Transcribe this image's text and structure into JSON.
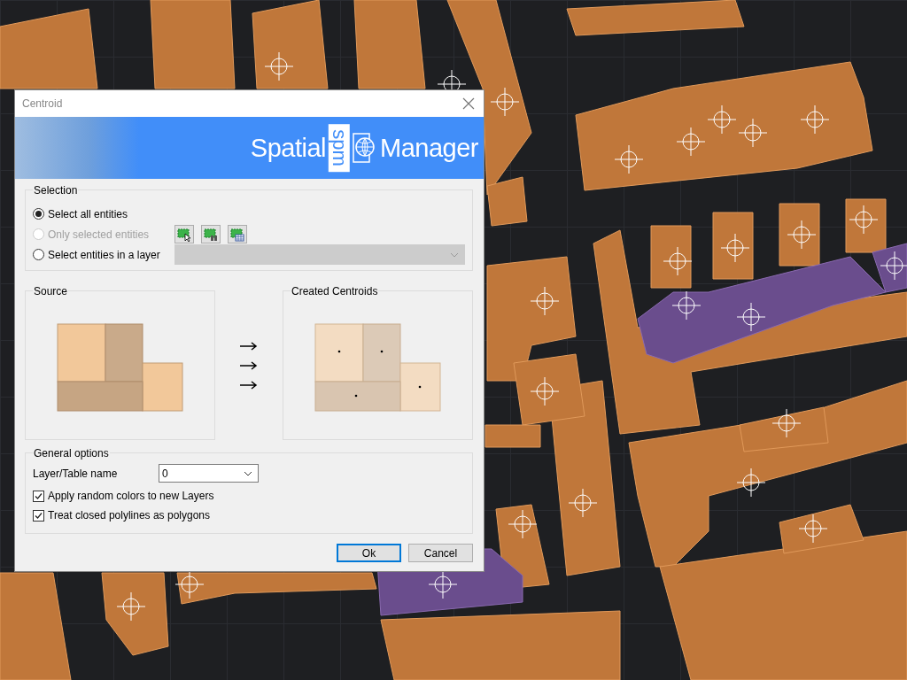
{
  "window": {
    "title": "Centroid"
  },
  "banner": {
    "logo_left": "Spatial",
    "logo_mark": "spm",
    "logo_right": "Manager"
  },
  "selection": {
    "title": "Selection",
    "options": [
      {
        "label": "Select all entities",
        "selected": true,
        "disabled": false
      },
      {
        "label": "Only selected entities",
        "selected": false,
        "disabled": true
      },
      {
        "label": "Select entities in a layer",
        "selected": false,
        "disabled": false
      }
    ],
    "layer_dropdown": {
      "disabled": true
    }
  },
  "source": {
    "title": "Source"
  },
  "result": {
    "title": "Created Centroids"
  },
  "general_options": {
    "title": "General options",
    "layer_table_name": {
      "label": "Layer/Table name",
      "value": "0"
    },
    "checkboxes": [
      {
        "label": "Apply random colors to new Layers",
        "checked": true
      },
      {
        "label": "Treat closed polylines as polygons",
        "checked": true
      }
    ]
  },
  "buttons": [
    {
      "label": "Ok",
      "default": true
    },
    {
      "label": "Cancel",
      "default": false
    }
  ]
}
